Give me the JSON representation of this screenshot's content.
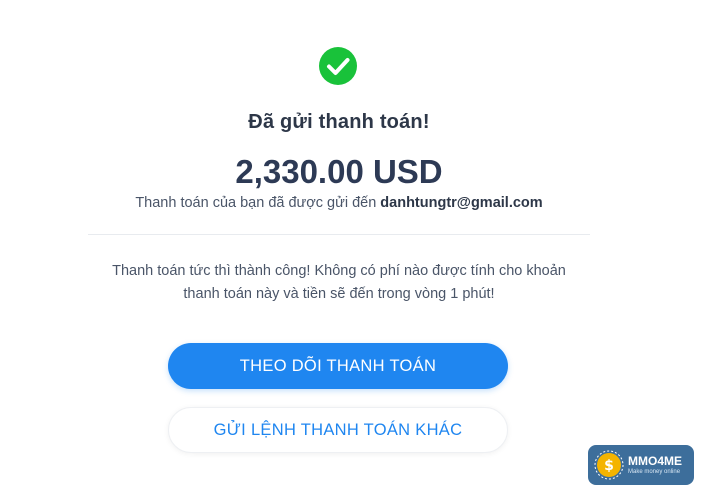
{
  "status": {
    "icon": "check-circle-icon",
    "icon_color": "#19c23a",
    "title": "Đã gửi thanh toán!"
  },
  "payment": {
    "amount": "2,330.00 USD",
    "sent_prefix": "Thanh toán của bạn đã được gửi đến",
    "recipient_email": "danhtungtr@gmail.com"
  },
  "notice": {
    "line1": "Thanh toán tức thì thành công! Không có phí nào được tính cho khoản",
    "line2": "thanh toán này và tiền sẽ đến trong vòng 1 phút!"
  },
  "actions": {
    "track_label": "THEO DÕI THANH TOÁN",
    "send_another_label": "GỬI LỆNH THANH TOÁN KHÁC",
    "accent_color": "#1f86f0"
  },
  "watermark": {
    "name": "MMO4ME",
    "tagline": "Make money online",
    "icon": "dollar-logo-icon"
  }
}
